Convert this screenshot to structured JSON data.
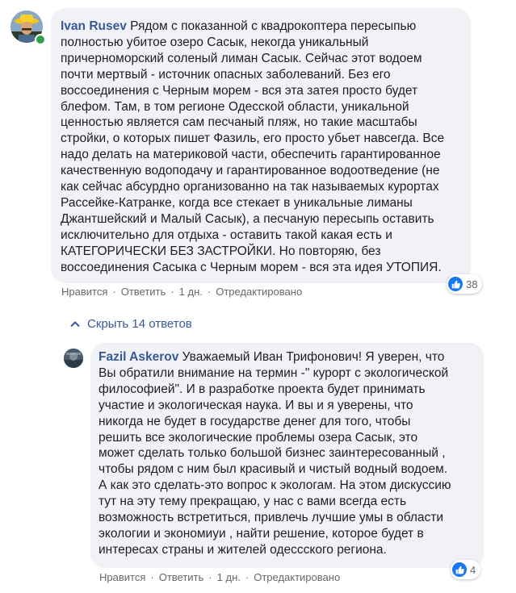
{
  "comment1": {
    "author": "Ivan Rusev",
    "text": "Рядом с показанной с квадрокоптера пересыпью\nполностью убитое озеро Сасык, некогда уникальный\nпричерноморский соленый лиман Сасык. Сейчас этот водоем\nпочти мертвый - источник опасных заболеваний. Без его\nвоссоединения с Черным морем - вся эта затея просто будет\nблефом. Там, в том регионе Одесской области, уникальной\nценностью является сам песчаный пляж, но такие масштабы\nстройки, о которых пишет Фазиль, его просто убьет навсегда. Все\nнадо делать на материковой части, обеспечить гарантированное\nкачественную водоподачу и гарантированное водоотведение (не\nкак сейчас абсурдно организованно на так называемых курортах\nРассейке-Катранке, когда все стекает в уникальные лиманы\nДжантшейский и Малый Сасык), а песчаную пересыпь оставить\nисключительно для отдыха - оставить такой какая есть и\nКАТЕГОРИЧЕСКИ БЕЗ ЗАСТРОЙКИ. Но повторяю, без\nвоссоединения Сасыка с Черным морем - вся эта идея УТОПИЯ.",
    "actions": {
      "like": "Нравится",
      "reply": "Ответить",
      "time": "1 дн.",
      "edited": "Отредактировано"
    },
    "reactions_count": "38",
    "accent": "#1877f2"
  },
  "replies_toggle": {
    "label": "Скрыть 14 ответов",
    "icon": "chevron-up-icon"
  },
  "comment2": {
    "author": "Fazil Askerov",
    "text": "Уважаемый Иван Трифонович! Я уверен, что\nВы обратили внимание на термин -\" курорт с экологической\nфилософией\". И в разработке проекта будет принимать\nучастие и экологическая наука. И вы и я уверены, что\nникогда не будет в государстве денег для того, чтобы\nрешить все экологические проблемы озера Сасык, это\nможет сделать только большой бизнес заинтересованный ,\nчтобы рядом с ним был красивый и чистый водный водоем.\nА как это сделать-это вопрос к экологам. На этом дискуссию\nтут на эту тему прекращаю, у нас с вами всегда есть\nвозможность встретиться, привлечь лучшие умы в области\nэкологии и экономиуи , найти решение, которое будет в\nинтересах страны и жителей одессского региона.",
    "actions": {
      "like": "Нравится",
      "reply": "Ответить",
      "time": "1 дн.",
      "edited": "Отредактировано"
    },
    "reactions_count": "4"
  },
  "colors": {
    "link": "#385898",
    "bubble": "#f0f2f5",
    "online": "#31a24c"
  }
}
